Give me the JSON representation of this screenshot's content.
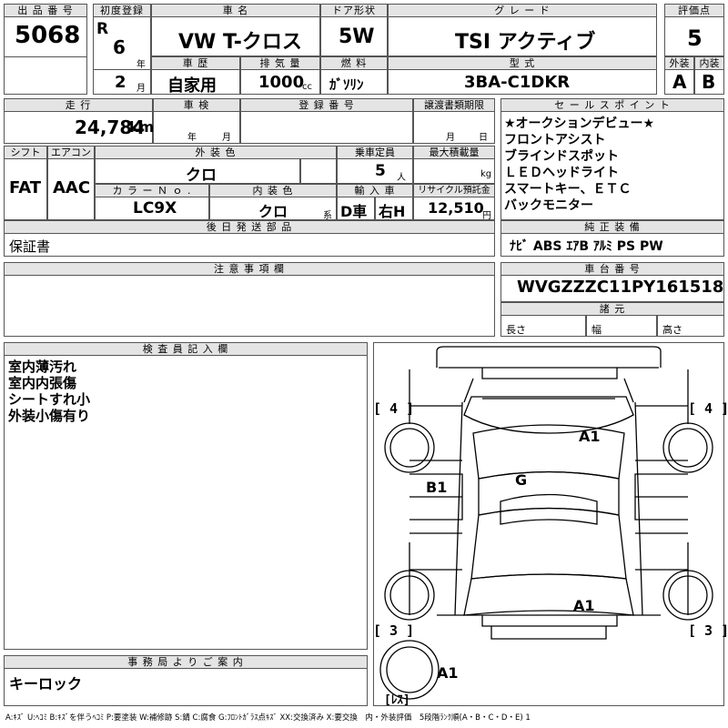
{
  "header": {
    "lot_no_label": "出 品 番 号",
    "lot_no": "5068",
    "first_reg_label": "初度登録",
    "era": "R",
    "year_value": "6",
    "year_unit": "年",
    "month_value": "2",
    "month_unit": "月",
    "car_name_label": "車 名",
    "car_name": "VW  T-クロス",
    "door_label": "ドア形状",
    "door": "5W",
    "grade_label": "グ レ ー ド",
    "grade": "TSI  アクティブ",
    "score_label": "評価点",
    "score": "5",
    "history_label": "車 歴",
    "history": "自家用",
    "displacement_label": "排 気 量",
    "displacement": "1000",
    "displacement_unit": "cc",
    "fuel_label": "燃 料",
    "fuel": "ｶﾞｿﾘﾝ",
    "model_label": "型 式",
    "model": "3BA-C1DKR",
    "exterior_label": "外装",
    "exterior": "A",
    "interior_label": "内装",
    "interior": "B"
  },
  "details": {
    "mileage_label": "走 行",
    "mileage": "24,784",
    "mileage_unit": "km",
    "inspection_label": "車 検",
    "inspection_year_unit": "年",
    "inspection_month_unit": "月",
    "registration_label": "登 録 番 号",
    "transfer_label": "譲渡書類期限",
    "transfer_month_unit": "月",
    "transfer_day_unit": "日",
    "shift_label": "シフト",
    "shift": "FAT",
    "ac_label": "エアコン",
    "ac": "AAC",
    "ext_color_label": "外 装 色",
    "ext_color": "クロ",
    "capacity_label": "乗車定員",
    "capacity": "5",
    "capacity_unit": "人",
    "max_load_label": "最大積載量",
    "max_load_unit": "kg",
    "color_no_label": "カ ラ ー Ｎ ｏ .",
    "color_no": "LC9X",
    "int_color_label": "内 装 色",
    "int_color": "クロ",
    "int_color_unit": "系",
    "import_label": "輸 入 車",
    "import_d": "D車",
    "import_h": "右H",
    "recycle_label": "リサイクル預託金",
    "recycle": "12,510",
    "recycle_unit": "円",
    "later_parts_label": "後 日 発 送 部 品",
    "later_parts": "保証書",
    "notes_label": "注 意 事 項 欄"
  },
  "sales_points": {
    "label": "セ ー ル ス ポ イ ン ト",
    "lines": [
      "★オークションデビュー★",
      "フロントアシスト",
      "ブラインドスポット",
      "ＬＥＤヘッドライト",
      "スマートキー、ＥＴＣ",
      "バックモニター"
    ]
  },
  "equipment": {
    "label": "純 正 装 備",
    "items": "ﾅﾋﾞ  ABS  ｴｱB  ｱﾙﾐ  PS  PW"
  },
  "chassis": {
    "label": "車 台 番 号",
    "number": "WVGZZZC11PY161518",
    "specs_label": "諸 元",
    "length_label": "長さ",
    "width_label": "幅",
    "height_label": "高さ"
  },
  "inspector": {
    "label": "検 査 員 記 入 欄",
    "lines": [
      "室内薄汚れ",
      "室内内張傷",
      "シートすれ小",
      "外装小傷有り"
    ]
  },
  "diagram": {
    "tire_fl": "[ 4 ]",
    "tire_fr": "[ 4 ]",
    "tire_rl": "[ 3 ]",
    "tire_rr": "[ 3 ]",
    "spare": "[ﾚｽ]",
    "mark_hood": "A1",
    "mark_roof": "G",
    "mark_left_door": "B1",
    "mark_trunk": "A1",
    "mark_rear": "A1"
  },
  "office": {
    "label": "事 務 局 よ り ご 案 内",
    "text": "キーロック"
  },
  "legend": {
    "text": "A:ｷｽﾞ U:ﾍｺﾐ B:ｷｽﾞを伴うﾍｺﾐ P:要塗装 W:補修跡 S:錆 C:腐食 G:ﾌﾛﾝﾄｶﾞﾗｽ点ｷｽﾞ XX:交換済み X:要交換　内・外装評価　5段階ﾗﾝｸ順(A・B・C・D・E) 1"
  }
}
